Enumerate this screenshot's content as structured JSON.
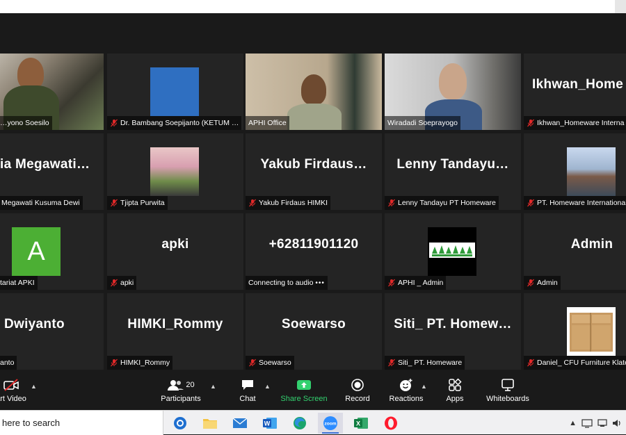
{
  "window": {
    "top_bar_color": "#ffffff"
  },
  "participants": [
    {
      "name": "…yono Soesilo",
      "display": "",
      "muted": false,
      "kind": "video",
      "active_speaker": true
    },
    {
      "name": "Dr. Bambang Soepijanto (KETUM …",
      "display": "",
      "muted": true,
      "kind": "image"
    },
    {
      "name": "APHI Office",
      "display": "",
      "muted": false,
      "kind": "video"
    },
    {
      "name": "Wiradadi Soeprayogo",
      "display": "",
      "muted": false,
      "kind": "video"
    },
    {
      "name": "Ikhwan_Homeware Interna",
      "display": "Ikhwan_Home",
      "muted": true,
      "kind": "name"
    },
    {
      "name": "Megawati Kusuma Dewi",
      "display": "ia  Megawati…",
      "muted": false,
      "kind": "name"
    },
    {
      "name": "Tjipta Purwita",
      "display": "",
      "muted": true,
      "kind": "image"
    },
    {
      "name": "Yakub Firdaus HIMKI",
      "display": "Yakub  Firdaus…",
      "muted": true,
      "kind": "name"
    },
    {
      "name": "Lenny Tandayu PT Homeware",
      "display": "Lenny  Tandayu…",
      "muted": true,
      "kind": "name"
    },
    {
      "name": "PT. Homeware International",
      "display": "",
      "muted": true,
      "kind": "image"
    },
    {
      "name": "tariat APKI",
      "display": "",
      "muted": false,
      "kind": "avatar",
      "avatar_letter": "A"
    },
    {
      "name": "apki",
      "display": "apki",
      "muted": true,
      "kind": "name"
    },
    {
      "name": "Connecting to audio",
      "display": "+62811901120",
      "muted": false,
      "kind": "name",
      "connecting": true,
      "dots": "•••"
    },
    {
      "name": "APHI _ Admin",
      "display": "",
      "muted": true,
      "kind": "image"
    },
    {
      "name": "Admin",
      "display": "Admin",
      "muted": true,
      "kind": "name"
    },
    {
      "name": "anto",
      "display": "Dwiyanto",
      "muted": false,
      "kind": "name"
    },
    {
      "name": "HIMKI_Rommy",
      "display": "HIMKI_Rommy",
      "muted": true,
      "kind": "name"
    },
    {
      "name": "Soewarso",
      "display": "Soewarso",
      "muted": true,
      "kind": "name"
    },
    {
      "name": "Siti_ PT. Homeware",
      "display": "Siti_  PT.  Homew…",
      "muted": true,
      "kind": "name"
    },
    {
      "name": "Daniel_ CFU Furniture Klate",
      "display": "",
      "muted": true,
      "kind": "image"
    }
  ],
  "toolbar": {
    "start_video": "art Video",
    "participants": "Participants",
    "participant_count": "20",
    "chat": "Chat",
    "share_screen": "Share Screen",
    "record": "Record",
    "reactions": "Reactions",
    "apps": "Apps",
    "whiteboards": "Whiteboards"
  },
  "taskbar": {
    "search_placeholder": " here to search",
    "zoom_label": "zoom"
  },
  "colors": {
    "active_speaker": "#9de12a",
    "muted_icon": "#e02828",
    "share_green": "#33d16f",
    "avatar_green": "#4caf34"
  }
}
